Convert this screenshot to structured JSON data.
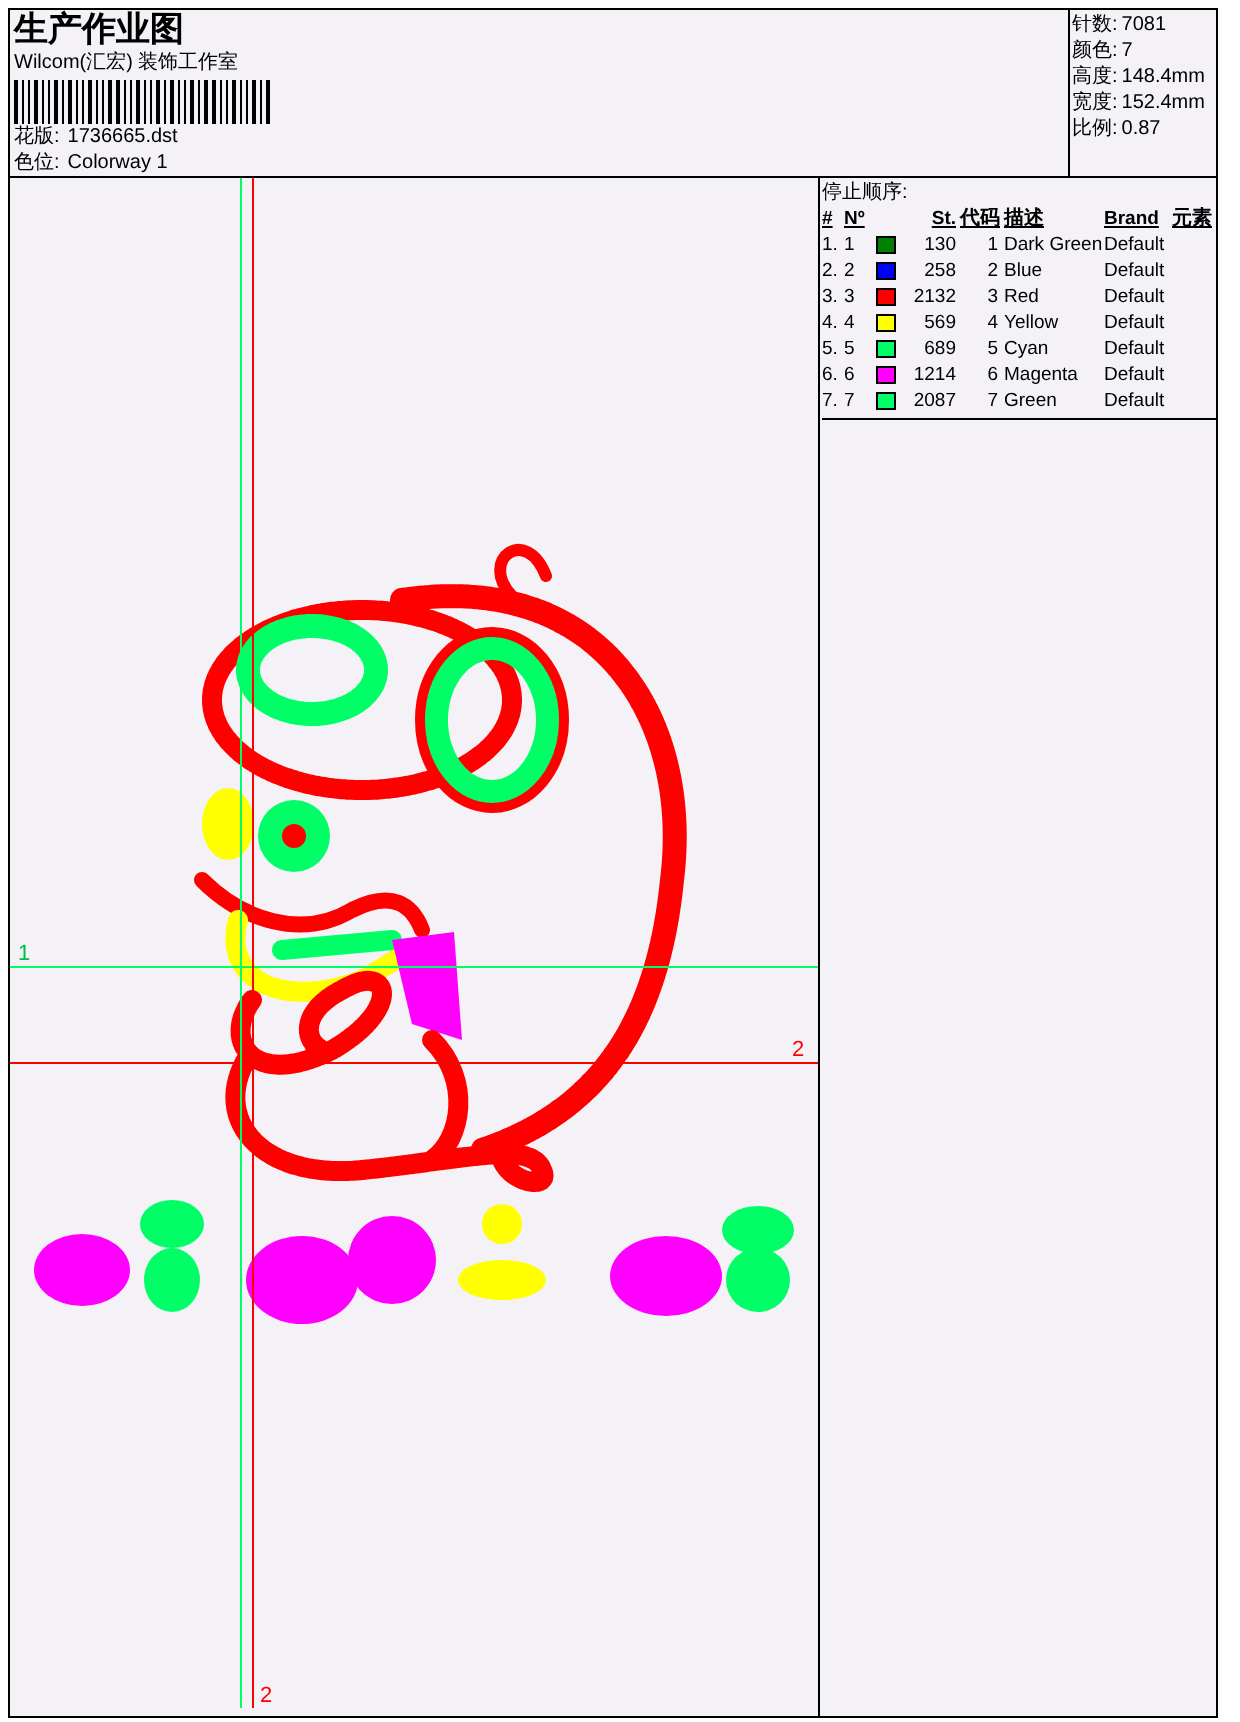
{
  "header": {
    "title": "生产作业图",
    "studio": "Wilcom(汇宏) 装饰工作室",
    "design_file": {
      "label": "花版:",
      "value": "1736665.dst"
    },
    "colorway": {
      "label": "色位:",
      "value": "Colorway 1"
    }
  },
  "stats": [
    {
      "label": "针数:",
      "value": "7081"
    },
    {
      "label": "颜色:",
      "value": "7"
    },
    {
      "label": "高度:",
      "value": "148.4mm"
    },
    {
      "label": "宽度:",
      "value": "152.4mm"
    },
    {
      "label": "比例:",
      "value": "0.87"
    }
  ],
  "stop_sequence": {
    "title": "停止顺序:",
    "columns": [
      "#",
      "Nº",
      "St.",
      "代码",
      "描述",
      "Brand",
      "元素"
    ],
    "rows": [
      {
        "index": "1.",
        "number": "1",
        "color": "#008000",
        "stitches": "130",
        "code": "1",
        "description": "Dark Green",
        "brand": "Default"
      },
      {
        "index": "2.",
        "number": "2",
        "color": "#0000ff",
        "stitches": "258",
        "code": "2",
        "description": "Blue",
        "brand": "Default"
      },
      {
        "index": "3.",
        "number": "3",
        "color": "#ff0000",
        "stitches": "2132",
        "code": "3",
        "description": "Red",
        "brand": "Default"
      },
      {
        "index": "4.",
        "number": "4",
        "color": "#ffff00",
        "stitches": "569",
        "code": "4",
        "description": "Yellow",
        "brand": "Default"
      },
      {
        "index": "5.",
        "number": "5",
        "color": "#00ff66",
        "stitches": "689",
        "code": "5",
        "description": "Cyan",
        "brand": "Default"
      },
      {
        "index": "6.",
        "number": "6",
        "color": "#ff00ff",
        "stitches": "1214",
        "code": "6",
        "description": "Magenta",
        "brand": "Default"
      },
      {
        "index": "7.",
        "number": "7",
        "color": "#00ff66",
        "stitches": "2087",
        "code": "7",
        "description": "Green",
        "brand": "Default"
      }
    ]
  },
  "canvas": {
    "guides": [
      {
        "kind": "horizontal",
        "label": "1",
        "color": "#00ff66"
      },
      {
        "kind": "horizontal",
        "label": "2",
        "color": "#ff0000"
      },
      {
        "kind": "vertical",
        "label": "2",
        "color": "#ff0000"
      }
    ]
  }
}
